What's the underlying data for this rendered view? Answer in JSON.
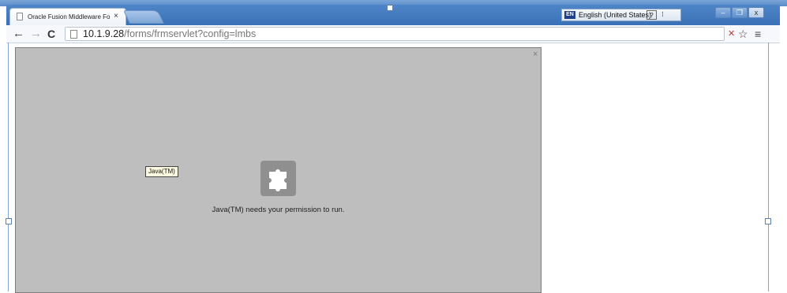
{
  "browser": {
    "tab": {
      "title": "Oracle Fusion Middleware Fo",
      "close_glyph": "×"
    },
    "address": {
      "host": "10.1.9.28",
      "path": "/forms/frmservlet?config=lmbs"
    },
    "nav": {
      "back_glyph": "←",
      "forward_glyph": "→",
      "reload_glyph": "C"
    },
    "toolbar_icons": {
      "bookmark_glyph": "☆",
      "menu_glyph": "≡",
      "blocked_glyph": "✕"
    }
  },
  "language_bar": {
    "badge": "EN",
    "label": "English (United States)",
    "help_glyph": "?",
    "menu_glyph": "⁝"
  },
  "window_controls": {
    "minimize": "–",
    "restore": "❐",
    "close": "x"
  },
  "plugin": {
    "tooltip": "Java(TM)",
    "message": "Java(TM) needs your permission to run.",
    "close_glyph": "×"
  },
  "colors": {
    "chrome_blue": "#3a70b5",
    "plugin_bg": "#bebebe",
    "puzzle_bg": "#8f8f8f"
  }
}
